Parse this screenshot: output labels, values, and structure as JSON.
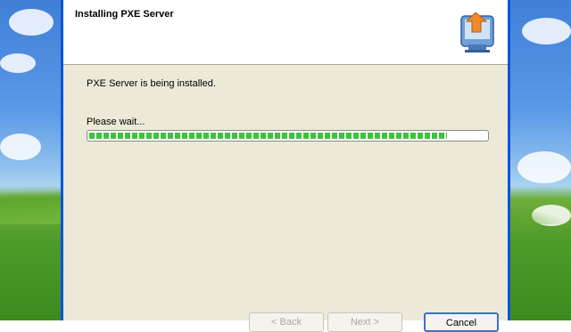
{
  "window": {
    "title": "Installing PXE Server",
    "header_icon": "installer-box-arrow-icon"
  },
  "content": {
    "status": "PXE Server is being installed.",
    "wait": "Please wait...",
    "progress": 0.9
  },
  "buttons": {
    "back": "< Back",
    "next": "Next >",
    "cancel": "Cancel"
  },
  "colors": {
    "progress": "#3fc23f",
    "window_border": "#0a55d8"
  }
}
